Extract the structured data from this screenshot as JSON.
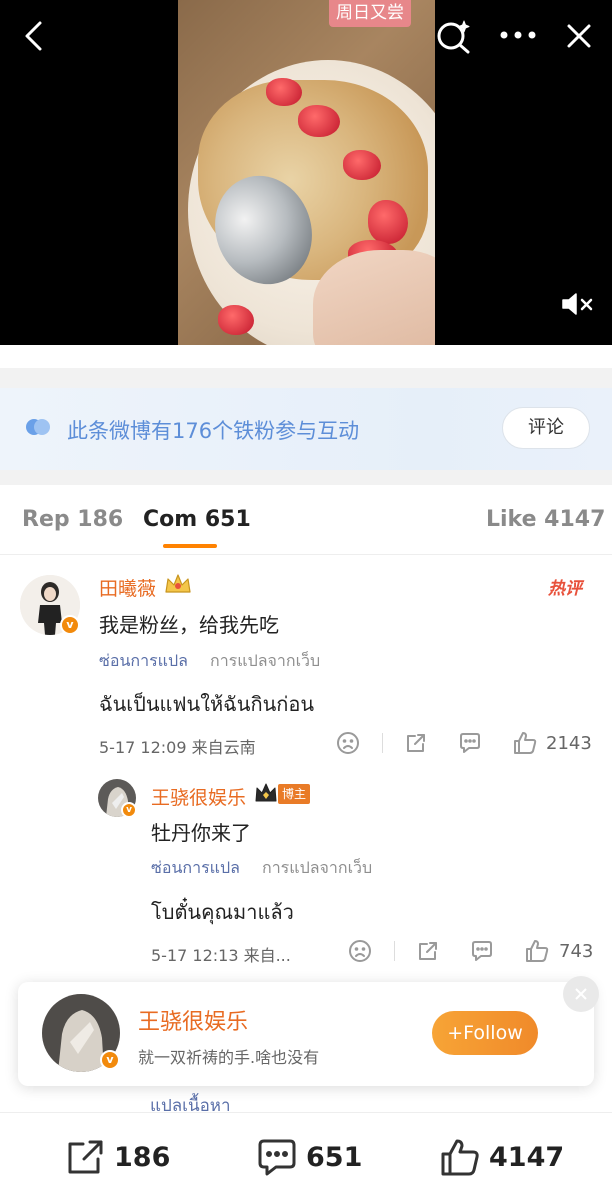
{
  "video": {
    "badge": "周日又尝",
    "icons": {
      "back": "back-arrow-icon",
      "search": "sparkle-search-icon",
      "more": "more-dots-icon",
      "close": "close-icon",
      "mute": "mute-icon"
    }
  },
  "fans_banner": {
    "text": "此条微博有176个铁粉参与互动",
    "button": "评论"
  },
  "tabs": [
    {
      "label": "Rep 186"
    },
    {
      "label": "Com 651"
    },
    {
      "label": "Like 4147"
    }
  ],
  "comments": [
    {
      "name": "田曦薇",
      "hot_label": "热评",
      "text": "我是粉丝，给我先吃",
      "hide_translation": "ซ่อนการแปล",
      "translation_source": "การแปลจากเว็บ",
      "translation": "ฉันเป็นแฟนให้ฉันกินก่อน",
      "meta": "5-17 12:09  来自云南",
      "likes": "2143"
    }
  ],
  "reply": {
    "name": "王骁很娱乐",
    "author_tag": "博主",
    "text": "牡丹你来了",
    "hide_translation": "ซ่อนการแปล",
    "translation_source": "การแปลจากเว็บ",
    "translation": "โบตั๋นคุณมาแล้ว",
    "meta": "5-17 12:13  来自...",
    "likes": "743"
  },
  "popup": {
    "name": "王骁很娱乐",
    "description": "就一双祈祷的手.啥也没有",
    "follow_button": "Follow"
  },
  "below_popup_text": "แปลเนื้อหา",
  "bottom_bar": {
    "reposts": "186",
    "comments": "651",
    "likes": "4147"
  },
  "colors": {
    "accent_orange": "#ff8200",
    "name_orange": "#e86b22",
    "fans_blue": "#5d8ed8",
    "hot_red": "#e8513b"
  }
}
